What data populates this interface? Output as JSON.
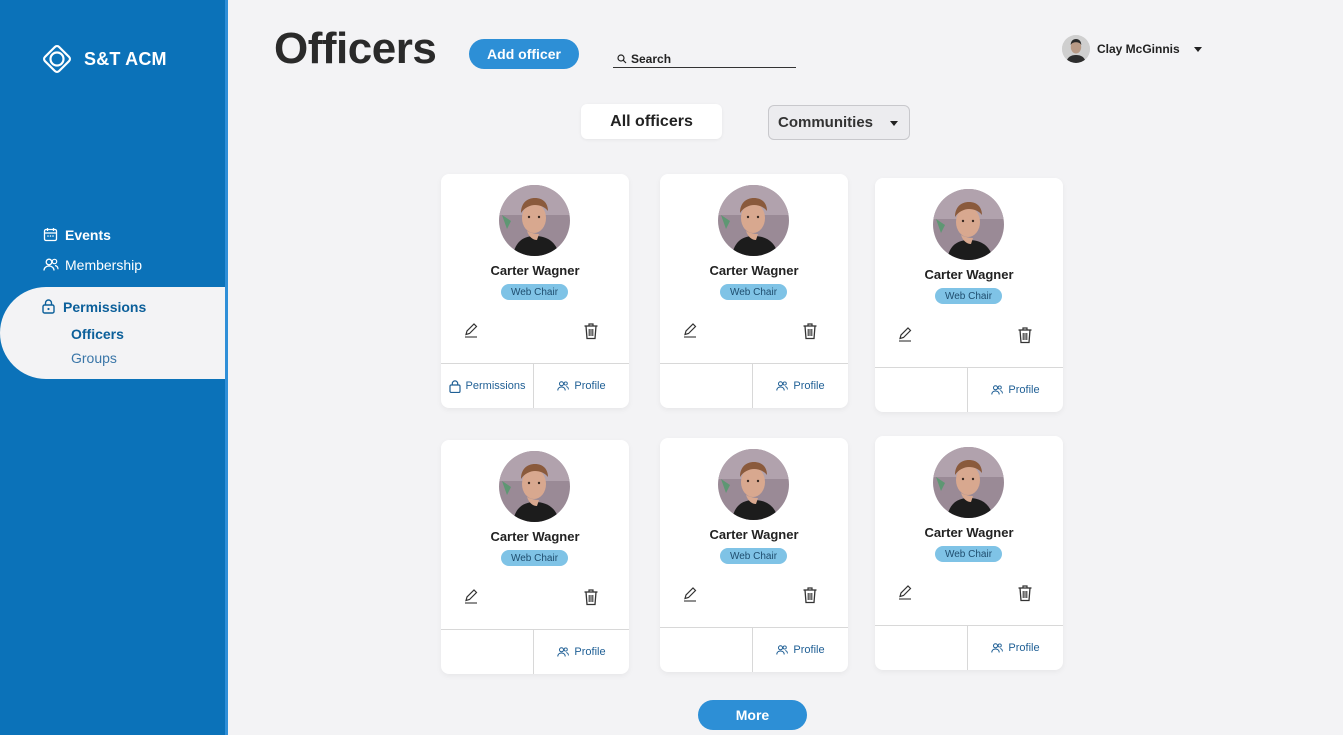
{
  "sidebar": {
    "brand": "S&T ACM",
    "nav": {
      "events": "Events",
      "membership": "Membership",
      "permissions": "Permissions",
      "officers": "Officers",
      "groups": "Groups"
    }
  },
  "header": {
    "title": "Officers",
    "add_button": "Add officer",
    "search_placeholder": "Search",
    "user_name": "Clay McGinnis"
  },
  "filters": {
    "all_officers": "All officers",
    "communities": "Communities"
  },
  "cards": [
    {
      "name": "Carter Wagner",
      "role": "Web Chair",
      "permissions_label": "Permissions",
      "profile_label": "Profile"
    },
    {
      "name": "Carter Wagner",
      "role": "Web Chair",
      "profile_label": "Profile"
    },
    {
      "name": "Carter Wagner",
      "role": "Web Chair",
      "profile_label": "Profile"
    },
    {
      "name": "Carter Wagner",
      "role": "Web Chair",
      "profile_label": "Profile"
    },
    {
      "name": "Carter Wagner",
      "role": "Web Chair",
      "profile_label": "Profile"
    },
    {
      "name": "Carter Wagner",
      "role": "Web Chair",
      "profile_label": "Profile"
    }
  ],
  "more_button": "More",
  "colors": {
    "sidebar": "#0b72b9",
    "accent": "#2d8fd6",
    "role_badge": "#7fc3e6",
    "background": "#f3f3f5"
  }
}
